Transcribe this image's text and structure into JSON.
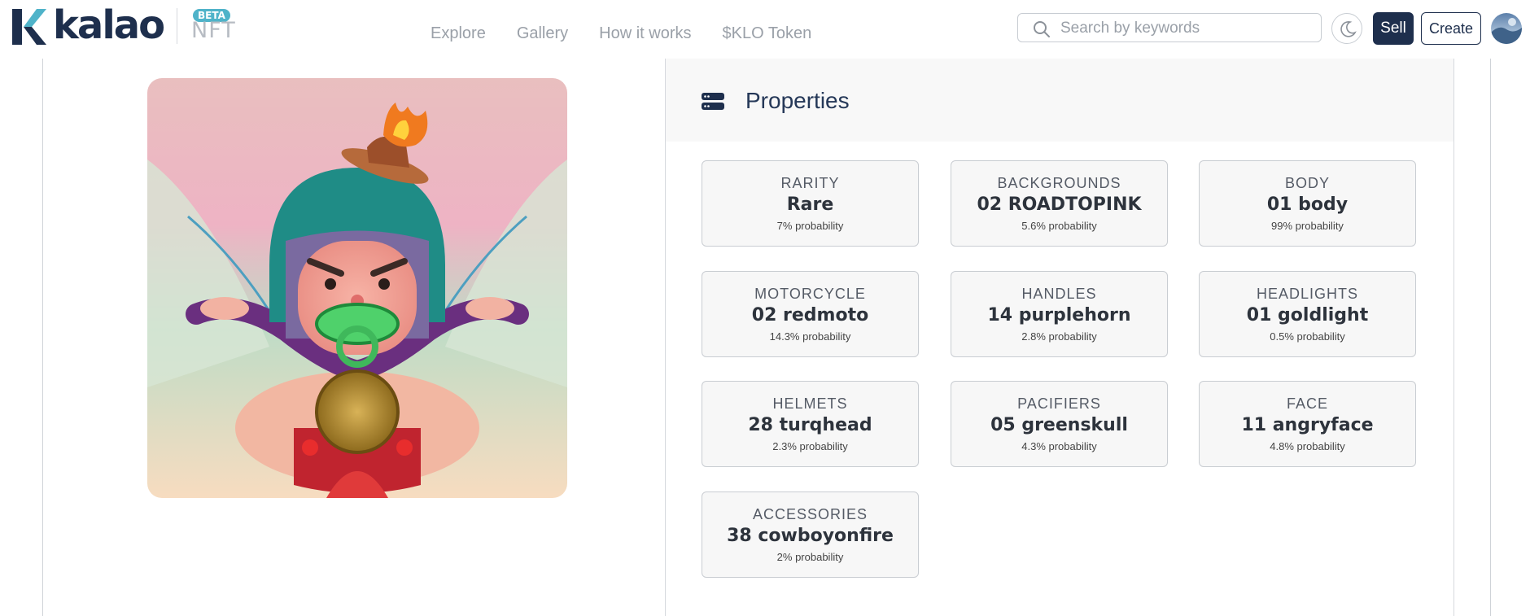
{
  "header": {
    "logo_text": "kalao",
    "beta_badge": "BETA",
    "nft_label": "NFT",
    "nav": [
      "Explore",
      "Gallery",
      "How it works",
      "$KLO Token"
    ],
    "search_placeholder": "Search by keywords",
    "sell_label": "Sell",
    "create_label": "Create",
    "icons": {
      "search": "search-icon",
      "theme": "moon-icon",
      "avatar": "user-avatar"
    }
  },
  "properties": {
    "title": "Properties",
    "icon": "server-icon",
    "items": [
      {
        "type": "RARITY",
        "value": "Rare",
        "probability": "7% probability"
      },
      {
        "type": "BACKGROUNDS",
        "value": "02 ROADTOPINK",
        "probability": "5.6% probability"
      },
      {
        "type": "BODY",
        "value": "01 body",
        "probability": "99% probability"
      },
      {
        "type": "MOTORCYCLE",
        "value": "02 redmoto",
        "probability": "14.3% probability"
      },
      {
        "type": "HANDLES",
        "value": "14 purplehorn",
        "probability": "2.8% probability"
      },
      {
        "type": "HEADLIGHTS",
        "value": "01 goldlight",
        "probability": "0.5% probability"
      },
      {
        "type": "HELMETS",
        "value": "28 turqhead",
        "probability": "2.3% probability"
      },
      {
        "type": "PACIFIERS",
        "value": "05 greenskull",
        "probability": "4.3% probability"
      },
      {
        "type": "FACE",
        "value": "11 angryface",
        "probability": "4.8% probability"
      },
      {
        "type": "ACCESSORIES",
        "value": "38 cowboyonfire",
        "probability": "2% probability"
      }
    ]
  },
  "colors": {
    "brand_navy": "#1e2f4d",
    "beta_teal": "#4fb3c9"
  }
}
